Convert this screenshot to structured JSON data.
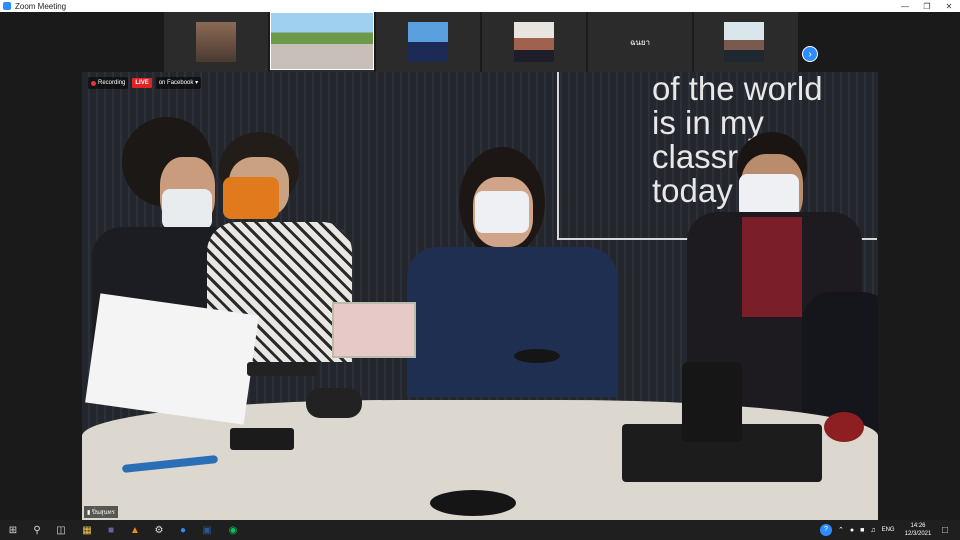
{
  "window": {
    "title": "Zoom Meeting"
  },
  "participants": [
    {
      "name": ""
    },
    {
      "name": ""
    },
    {
      "name": ""
    },
    {
      "name": ""
    },
    {
      "name": "ฉนยา"
    },
    {
      "name": ""
    }
  ],
  "recording": {
    "recording_label": "Recording",
    "live_label": "LIVE",
    "destination_label": "on Facebook"
  },
  "wall_text": "of the world\nis in my\nclassr  m\ntoday",
  "speaker": {
    "name": "ปิ่นสุนทร"
  },
  "taskbar": {
    "language": "ENG",
    "time": "14:26",
    "date": "12/3/2021",
    "notification_count": "2"
  },
  "colors": {
    "zoom_blue": "#2d8cff",
    "live_red": "#e02424",
    "mask_orange": "#e07a1c"
  },
  "icons": [
    "windows-start-icon",
    "search-icon",
    "task-view-icon",
    "file-explorer-icon",
    "teams-icon",
    "vlc-icon",
    "settings-icon",
    "zoom-icon",
    "word-icon",
    "line-icon"
  ]
}
